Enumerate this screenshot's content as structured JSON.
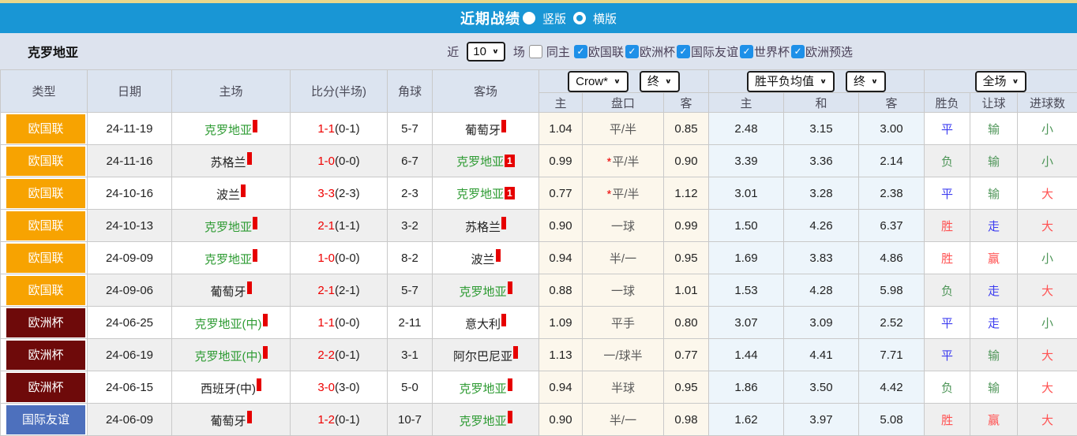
{
  "title_bar": {
    "title": "近期战绩",
    "options": [
      {
        "label": "竖版",
        "selected": true
      },
      {
        "label": "横版",
        "selected": false
      }
    ]
  },
  "filter_bar": {
    "team": "克罗地亚",
    "near_label": "近",
    "matches_select": "10",
    "matches_label": "场",
    "same_home": {
      "label": "同主",
      "checked": false
    },
    "competitions": [
      {
        "label": "欧国联",
        "checked": true
      },
      {
        "label": "欧洲杯",
        "checked": true
      },
      {
        "label": "国际友谊",
        "checked": true
      },
      {
        "label": "世界杯",
        "checked": true
      },
      {
        "label": "欧洲预选",
        "checked": true
      }
    ]
  },
  "table": {
    "left_headers": [
      "类型",
      "日期",
      "主场",
      "比分(半场)",
      "角球",
      "客场"
    ],
    "odds_group": {
      "selects": [
        "Crow*",
        "终"
      ],
      "sub": [
        "主",
        "盘口",
        "客"
      ]
    },
    "avg_group": {
      "selects": [
        "胜平负均值",
        "终"
      ],
      "sub": [
        "主",
        "和",
        "客"
      ]
    },
    "result_group": {
      "selects": [
        "全场"
      ],
      "sub": [
        "胜负",
        "让球",
        "进球数"
      ]
    },
    "rows": [
      {
        "type": "欧国联",
        "date": "24-11-19",
        "home": {
          "name": "克罗地亚",
          "green": true,
          "badge": ""
        },
        "score_full": "1-1",
        "score_half": "(0-1)",
        "corners": "5-7",
        "away": {
          "name": "葡萄牙",
          "green": false,
          "badge": ""
        },
        "odds_home": "1.04",
        "handicap": "平/半",
        "odds_away": "0.85",
        "avg_home": "2.48",
        "avg_draw": "3.15",
        "avg_away": "3.00",
        "res_wdl": {
          "t": "平",
          "c": "blue"
        },
        "res_handicap": {
          "t": "输",
          "c": "green"
        },
        "res_goals": {
          "t": "小",
          "c": "green"
        }
      },
      {
        "type": "欧国联",
        "date": "24-11-16",
        "home": {
          "name": "苏格兰",
          "green": false,
          "badge": ""
        },
        "score_full": "1-0",
        "score_half": "(0-0)",
        "corners": "6-7",
        "away": {
          "name": "克罗地亚",
          "green": true,
          "badge": "1"
        },
        "odds_home": "0.99",
        "handicap": "*平/半",
        "odds_away": "0.90",
        "avg_home": "3.39",
        "avg_draw": "3.36",
        "avg_away": "2.14",
        "res_wdl": {
          "t": "负",
          "c": "green"
        },
        "res_handicap": {
          "t": "输",
          "c": "green"
        },
        "res_goals": {
          "t": "小",
          "c": "green"
        }
      },
      {
        "type": "欧国联",
        "date": "24-10-16",
        "home": {
          "name": "波兰",
          "green": false,
          "badge": ""
        },
        "score_full": "3-3",
        "score_half": "(2-3)",
        "corners": "2-3",
        "away": {
          "name": "克罗地亚",
          "green": true,
          "badge": "1"
        },
        "odds_home": "0.77",
        "handicap": "*平/半",
        "odds_away": "1.12",
        "avg_home": "3.01",
        "avg_draw": "3.28",
        "avg_away": "2.38",
        "res_wdl": {
          "t": "平",
          "c": "blue"
        },
        "res_handicap": {
          "t": "输",
          "c": "green"
        },
        "res_goals": {
          "t": "大",
          "c": "red"
        }
      },
      {
        "type": "欧国联",
        "date": "24-10-13",
        "home": {
          "name": "克罗地亚",
          "green": true,
          "badge": ""
        },
        "score_full": "2-1",
        "score_half": "(1-1)",
        "corners": "3-2",
        "away": {
          "name": "苏格兰",
          "green": false,
          "badge": ""
        },
        "odds_home": "0.90",
        "handicap": "一球",
        "odds_away": "0.99",
        "avg_home": "1.50",
        "avg_draw": "4.26",
        "avg_away": "6.37",
        "res_wdl": {
          "t": "胜",
          "c": "red"
        },
        "res_handicap": {
          "t": "走",
          "c": "blue"
        },
        "res_goals": {
          "t": "大",
          "c": "red"
        }
      },
      {
        "type": "欧国联",
        "date": "24-09-09",
        "home": {
          "name": "克罗地亚",
          "green": true,
          "badge": ""
        },
        "score_full": "1-0",
        "score_half": "(0-0)",
        "corners": "8-2",
        "away": {
          "name": "波兰",
          "green": false,
          "badge": ""
        },
        "odds_home": "0.94",
        "handicap": "半/一",
        "odds_away": "0.95",
        "avg_home": "1.69",
        "avg_draw": "3.83",
        "avg_away": "4.86",
        "res_wdl": {
          "t": "胜",
          "c": "red"
        },
        "res_handicap": {
          "t": "赢",
          "c": "red"
        },
        "res_goals": {
          "t": "小",
          "c": "green"
        }
      },
      {
        "type": "欧国联",
        "date": "24-09-06",
        "home": {
          "name": "葡萄牙",
          "green": false,
          "badge": ""
        },
        "score_full": "2-1",
        "score_half": "(2-1)",
        "corners": "5-7",
        "away": {
          "name": "克罗地亚",
          "green": true,
          "badge": ""
        },
        "odds_home": "0.88",
        "handicap": "一球",
        "odds_away": "1.01",
        "avg_home": "1.53",
        "avg_draw": "4.28",
        "avg_away": "5.98",
        "res_wdl": {
          "t": "负",
          "c": "green"
        },
        "res_handicap": {
          "t": "走",
          "c": "blue"
        },
        "res_goals": {
          "t": "大",
          "c": "red"
        }
      },
      {
        "type": "欧洲杯",
        "date": "24-06-25",
        "home": {
          "name": "克罗地亚(中)",
          "green": true,
          "badge": ""
        },
        "score_full": "1-1",
        "score_half": "(0-0)",
        "corners": "2-11",
        "away": {
          "name": "意大利",
          "green": false,
          "badge": ""
        },
        "odds_home": "1.09",
        "handicap": "平手",
        "odds_away": "0.80",
        "avg_home": "3.07",
        "avg_draw": "3.09",
        "avg_away": "2.52",
        "res_wdl": {
          "t": "平",
          "c": "blue"
        },
        "res_handicap": {
          "t": "走",
          "c": "blue"
        },
        "res_goals": {
          "t": "小",
          "c": "green"
        }
      },
      {
        "type": "欧洲杯",
        "date": "24-06-19",
        "home": {
          "name": "克罗地亚(中)",
          "green": true,
          "badge": ""
        },
        "score_full": "2-2",
        "score_half": "(0-1)",
        "corners": "3-1",
        "away": {
          "name": "阿尔巴尼亚",
          "green": false,
          "badge": ""
        },
        "odds_home": "1.13",
        "handicap": "一/球半",
        "odds_away": "0.77",
        "avg_home": "1.44",
        "avg_draw": "4.41",
        "avg_away": "7.71",
        "res_wdl": {
          "t": "平",
          "c": "blue"
        },
        "res_handicap": {
          "t": "输",
          "c": "green"
        },
        "res_goals": {
          "t": "大",
          "c": "red"
        }
      },
      {
        "type": "欧洲杯",
        "date": "24-06-15",
        "home": {
          "name": "西班牙(中)",
          "green": false,
          "badge": ""
        },
        "score_full": "3-0",
        "score_half": "(3-0)",
        "corners": "5-0",
        "away": {
          "name": "克罗地亚",
          "green": true,
          "badge": ""
        },
        "odds_home": "0.94",
        "handicap": "半球",
        "odds_away": "0.95",
        "avg_home": "1.86",
        "avg_draw": "3.50",
        "avg_away": "4.42",
        "res_wdl": {
          "t": "负",
          "c": "green"
        },
        "res_handicap": {
          "t": "输",
          "c": "green"
        },
        "res_goals": {
          "t": "大",
          "c": "red"
        }
      },
      {
        "type": "国际友谊",
        "date": "24-06-09",
        "home": {
          "name": "葡萄牙",
          "green": false,
          "badge": ""
        },
        "score_full": "1-2",
        "score_half": "(0-1)",
        "corners": "10-7",
        "away": {
          "name": "克罗地亚",
          "green": true,
          "badge": ""
        },
        "odds_home": "0.90",
        "handicap": "半/一",
        "odds_away": "0.98",
        "avg_home": "1.62",
        "avg_draw": "3.97",
        "avg_away": "5.08",
        "res_wdl": {
          "t": "胜",
          "c": "red"
        },
        "res_handicap": {
          "t": "赢",
          "c": "red"
        },
        "res_goals": {
          "t": "大",
          "c": "red"
        }
      }
    ]
  },
  "colors": {
    "title_bar_bg": "#1996d5",
    "league": {
      "欧国联": "#f7a301",
      "欧洲杯": "#6e0a0a",
      "国际友谊": "#4d70bd"
    },
    "result": {
      "blue": "#3c3cf0",
      "green": "#4f9659",
      "red": "#ff5252"
    },
    "team_link": "#2e9b33",
    "score_red": "#ee0000",
    "checkbox_blue": "#1e90e8"
  }
}
